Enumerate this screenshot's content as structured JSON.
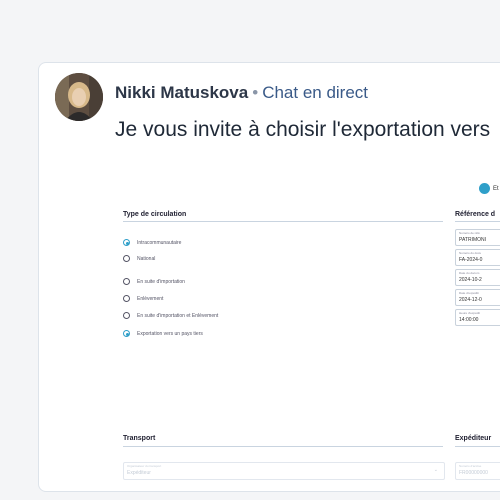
{
  "post": {
    "author": "Nikki Matuskova",
    "separator": "•",
    "channel": "Chat en direct",
    "message": "Je vous invite à choisir l'exportation vers"
  },
  "form": {
    "step_label": "Et",
    "circulation": {
      "title": "Type de circulation",
      "options": [
        {
          "label": "Intracommunautaire",
          "checked": true
        },
        {
          "label": "National",
          "checked": false
        },
        {
          "label": "En suite d'importation",
          "checked": false
        },
        {
          "label": "Enlèvement",
          "checked": false
        },
        {
          "label": "En suite d'importation et Enlèvement",
          "checked": false
        },
        {
          "label": "Exportation vers un pays tiers",
          "checked": true
        }
      ]
    },
    "reference": {
      "title": "Référence d",
      "fields": [
        {
          "label": "Numéro de réfé",
          "value": "PATRIMONI"
        },
        {
          "label": "Numéro du docu",
          "value": "FA-2024-0"
        },
        {
          "label": "Date du docum",
          "value": "2024-10-2"
        },
        {
          "label": "Date d'expéditi",
          "value": "2024-12-0"
        },
        {
          "label": "Heure d'expédit",
          "value": "14:00:00"
        }
      ]
    },
    "transport": {
      "title": "Transport",
      "select_label": "Organisateur du transport",
      "select_value": "Expéditeur"
    },
    "expediteur": {
      "title": "Expéditeur",
      "field_label": "Numéro d'accise",
      "field_value": "FR00000000"
    }
  },
  "colors": {
    "accent": "#2f9fc9",
    "author_text": "#2d3748",
    "channel_text": "#3a5a88"
  }
}
